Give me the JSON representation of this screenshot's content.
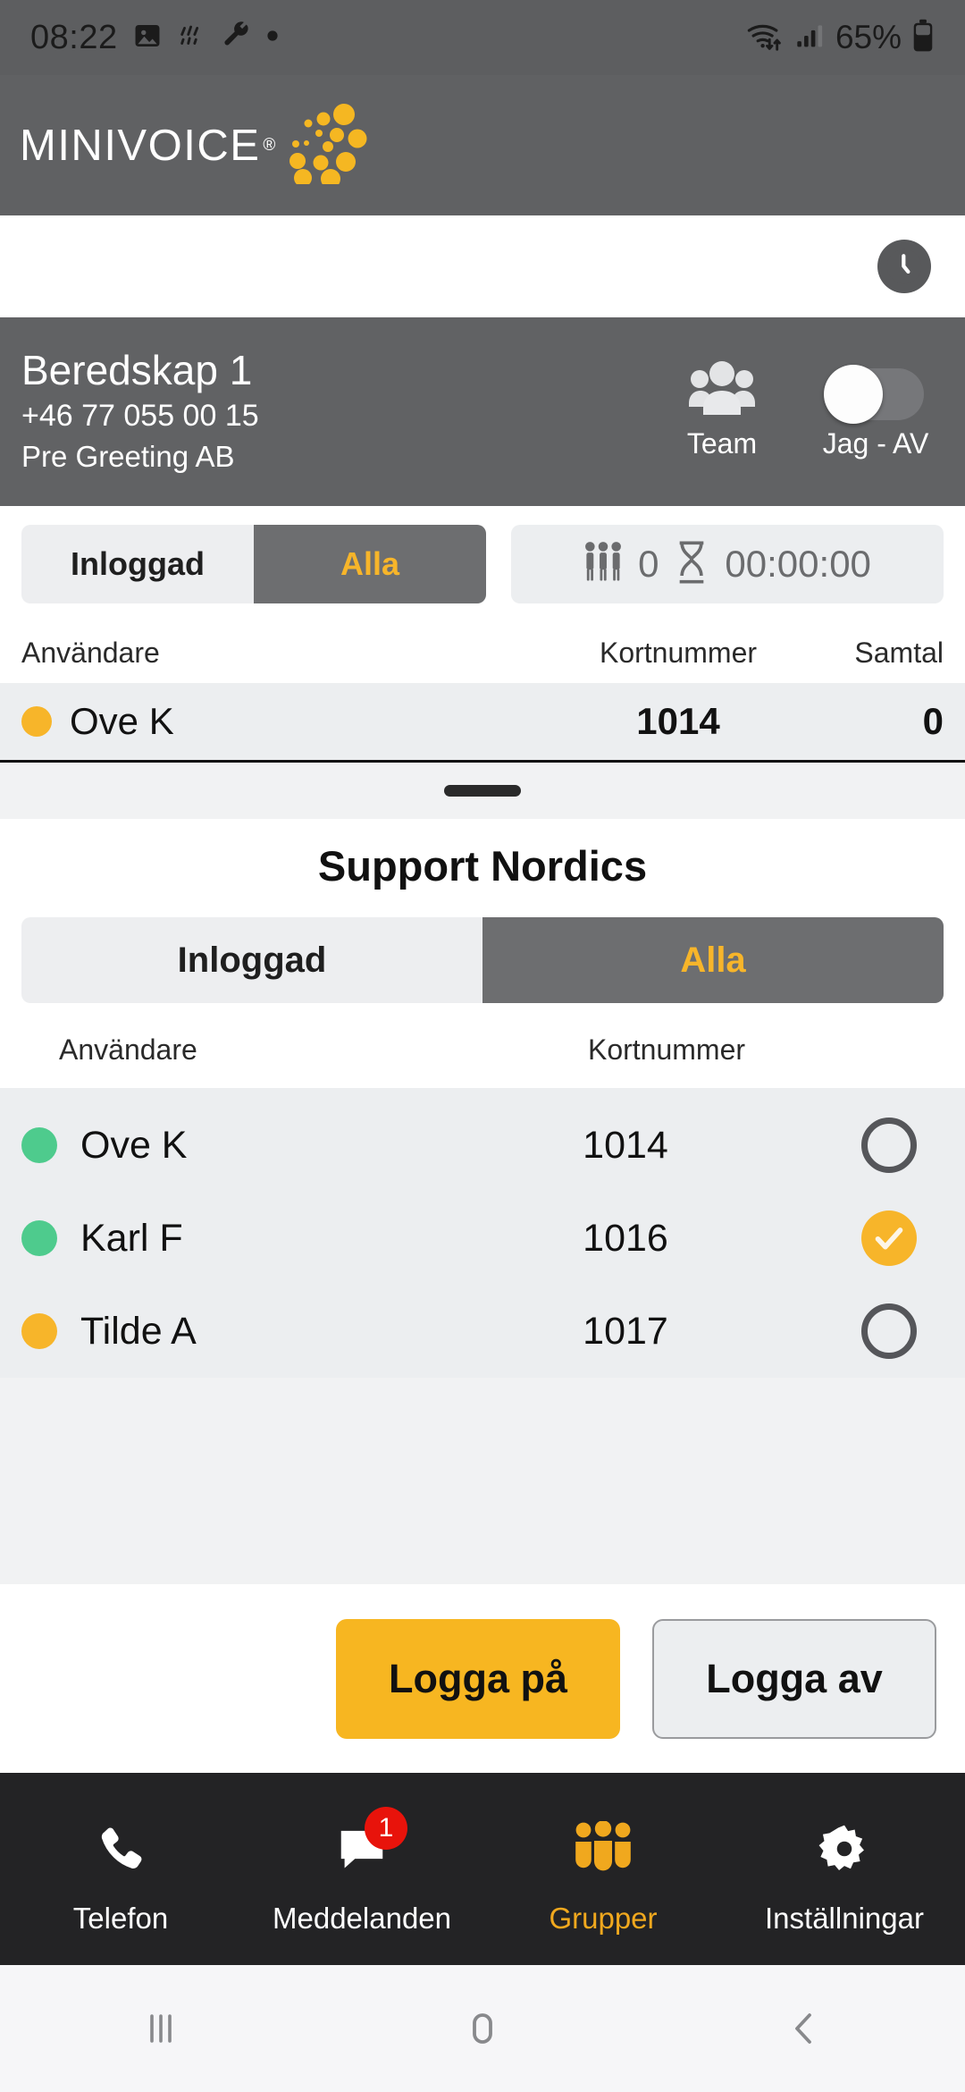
{
  "statusbar": {
    "time": "08:22",
    "battery_percent": "65%",
    "icons": [
      "image-icon",
      "weather-icon",
      "wrench-icon",
      "dot-icon",
      "wifi-icon",
      "cellular-signal-icon",
      "battery-icon"
    ]
  },
  "brand": {
    "name": "MINIVOICE",
    "registered_mark": "®"
  },
  "toolbar": {
    "clock_icon": "clock-icon"
  },
  "group_header": {
    "title": "Beredskap 1",
    "phone": "+46 77 055 00 15",
    "company": "Pre Greeting AB",
    "team_label": "Team",
    "toggle_label": "Jag - AV",
    "toggle_state": "off"
  },
  "background_view": {
    "segments": [
      {
        "label": "Inloggad",
        "active": false
      },
      {
        "label": "Alla",
        "active": true
      }
    ],
    "stats": {
      "people_icon": "people-standing-icon",
      "people_count": "0",
      "timer_icon": "hourglass-icon",
      "timer_value": "00:00:00"
    },
    "columns": [
      "Användare",
      "Kortnummer",
      "Samtal"
    ],
    "row": {
      "status": "away",
      "name": "Ove K",
      "kortnummer": "1014",
      "samtal": "0"
    }
  },
  "sheet": {
    "title": "Support Nordics",
    "segments": [
      {
        "label": "Inloggad",
        "active": false
      },
      {
        "label": "Alla",
        "active": true
      }
    ],
    "columns": [
      "Användare",
      "Kortnummer",
      ""
    ],
    "rows": [
      {
        "status": "online",
        "name": "Ove K",
        "kortnummer": "1014",
        "selected": false
      },
      {
        "status": "online",
        "name": "Karl F",
        "kortnummer": "1016",
        "selected": true
      },
      {
        "status": "away",
        "name": "Tilde A",
        "kortnummer": "1017",
        "selected": false
      }
    ]
  },
  "actions": {
    "login": "Logga på",
    "logout": "Logga av"
  },
  "bottom_nav": [
    {
      "label": "Telefon",
      "icon": "phone-icon",
      "active": false,
      "badge": ""
    },
    {
      "label": "Meddelanden",
      "icon": "message-icon",
      "active": false,
      "badge": "1"
    },
    {
      "label": "Grupper",
      "icon": "groups-icon",
      "active": true,
      "badge": ""
    },
    {
      "label": "Inställningar",
      "icon": "gear-icon",
      "active": false,
      "badge": ""
    }
  ],
  "android_nav": [
    {
      "icon": "recents-icon"
    },
    {
      "icon": "home-icon"
    },
    {
      "icon": "back-icon"
    }
  ],
  "colors": {
    "accent_yellow": "#f7b52a",
    "header_gray": "#616264",
    "status_online_green": "#4ecb8d",
    "status_away_orange": "#f7b52a",
    "badge_red": "#e8130b",
    "nav_dark": "#232325"
  }
}
